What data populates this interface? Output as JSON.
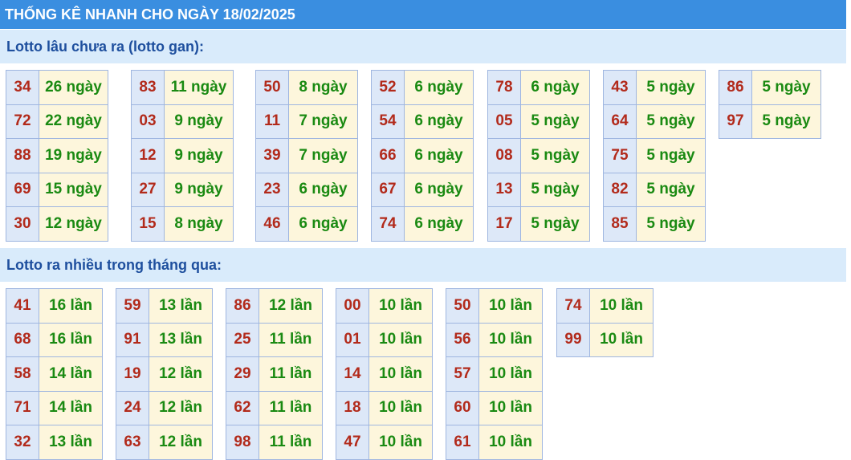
{
  "header": {
    "title": "THỐNG KÊ NHANH CHO NGÀY 18/02/2025"
  },
  "gan": {
    "title": "Lotto lâu chưa ra (lotto gan):",
    "columns": [
      [
        [
          "34",
          "26 ngày"
        ],
        [
          "72",
          "22 ngày"
        ],
        [
          "88",
          "19 ngày"
        ],
        [
          "69",
          "15 ngày"
        ],
        [
          "30",
          "12 ngày"
        ]
      ],
      [
        [
          "83",
          "11 ngày"
        ],
        [
          "03",
          "9 ngày"
        ],
        [
          "12",
          "9 ngày"
        ],
        [
          "27",
          "9 ngày"
        ],
        [
          "15",
          "8 ngày"
        ]
      ],
      [
        [
          "50",
          "8 ngày"
        ],
        [
          "11",
          "7 ngày"
        ],
        [
          "39",
          "7 ngày"
        ],
        [
          "23",
          "6 ngày"
        ],
        [
          "46",
          "6 ngày"
        ]
      ],
      [
        [
          "52",
          "6 ngày"
        ],
        [
          "54",
          "6 ngày"
        ],
        [
          "66",
          "6 ngày"
        ],
        [
          "67",
          "6 ngày"
        ],
        [
          "74",
          "6 ngày"
        ]
      ],
      [
        [
          "78",
          "6 ngày"
        ],
        [
          "05",
          "5 ngày"
        ],
        [
          "08",
          "5 ngày"
        ],
        [
          "13",
          "5 ngày"
        ],
        [
          "17",
          "5 ngày"
        ]
      ],
      [
        [
          "43",
          "5 ngày"
        ],
        [
          "64",
          "5 ngày"
        ],
        [
          "75",
          "5 ngày"
        ],
        [
          "82",
          "5 ngày"
        ],
        [
          "85",
          "5 ngày"
        ]
      ],
      [
        [
          "86",
          "5 ngày"
        ],
        [
          "97",
          "5 ngày"
        ]
      ]
    ]
  },
  "nhieu": {
    "title": "Lotto ra nhiều trong tháng qua:",
    "columns": [
      [
        [
          "41",
          "16 lần"
        ],
        [
          "68",
          "16 lần"
        ],
        [
          "58",
          "14 lần"
        ],
        [
          "71",
          "14 lần"
        ],
        [
          "32",
          "13 lần"
        ]
      ],
      [
        [
          "59",
          "13 lần"
        ],
        [
          "91",
          "13 lần"
        ],
        [
          "19",
          "12 lần"
        ],
        [
          "24",
          "12 lần"
        ],
        [
          "63",
          "12 lần"
        ]
      ],
      [
        [
          "86",
          "12 lần"
        ],
        [
          "25",
          "11 lần"
        ],
        [
          "29",
          "11 lần"
        ],
        [
          "62",
          "11 lần"
        ],
        [
          "98",
          "11 lần"
        ]
      ],
      [
        [
          "00",
          "10 lần"
        ],
        [
          "01",
          "10 lần"
        ],
        [
          "14",
          "10 lần"
        ],
        [
          "18",
          "10 lần"
        ],
        [
          "47",
          "10 lần"
        ]
      ],
      [
        [
          "50",
          "10 lần"
        ],
        [
          "56",
          "10 lần"
        ],
        [
          "57",
          "10 lần"
        ],
        [
          "60",
          "10 lần"
        ],
        [
          "61",
          "10 lần"
        ]
      ],
      [
        [
          "74",
          "10 lần"
        ],
        [
          "99",
          "10 lần"
        ]
      ]
    ]
  }
}
